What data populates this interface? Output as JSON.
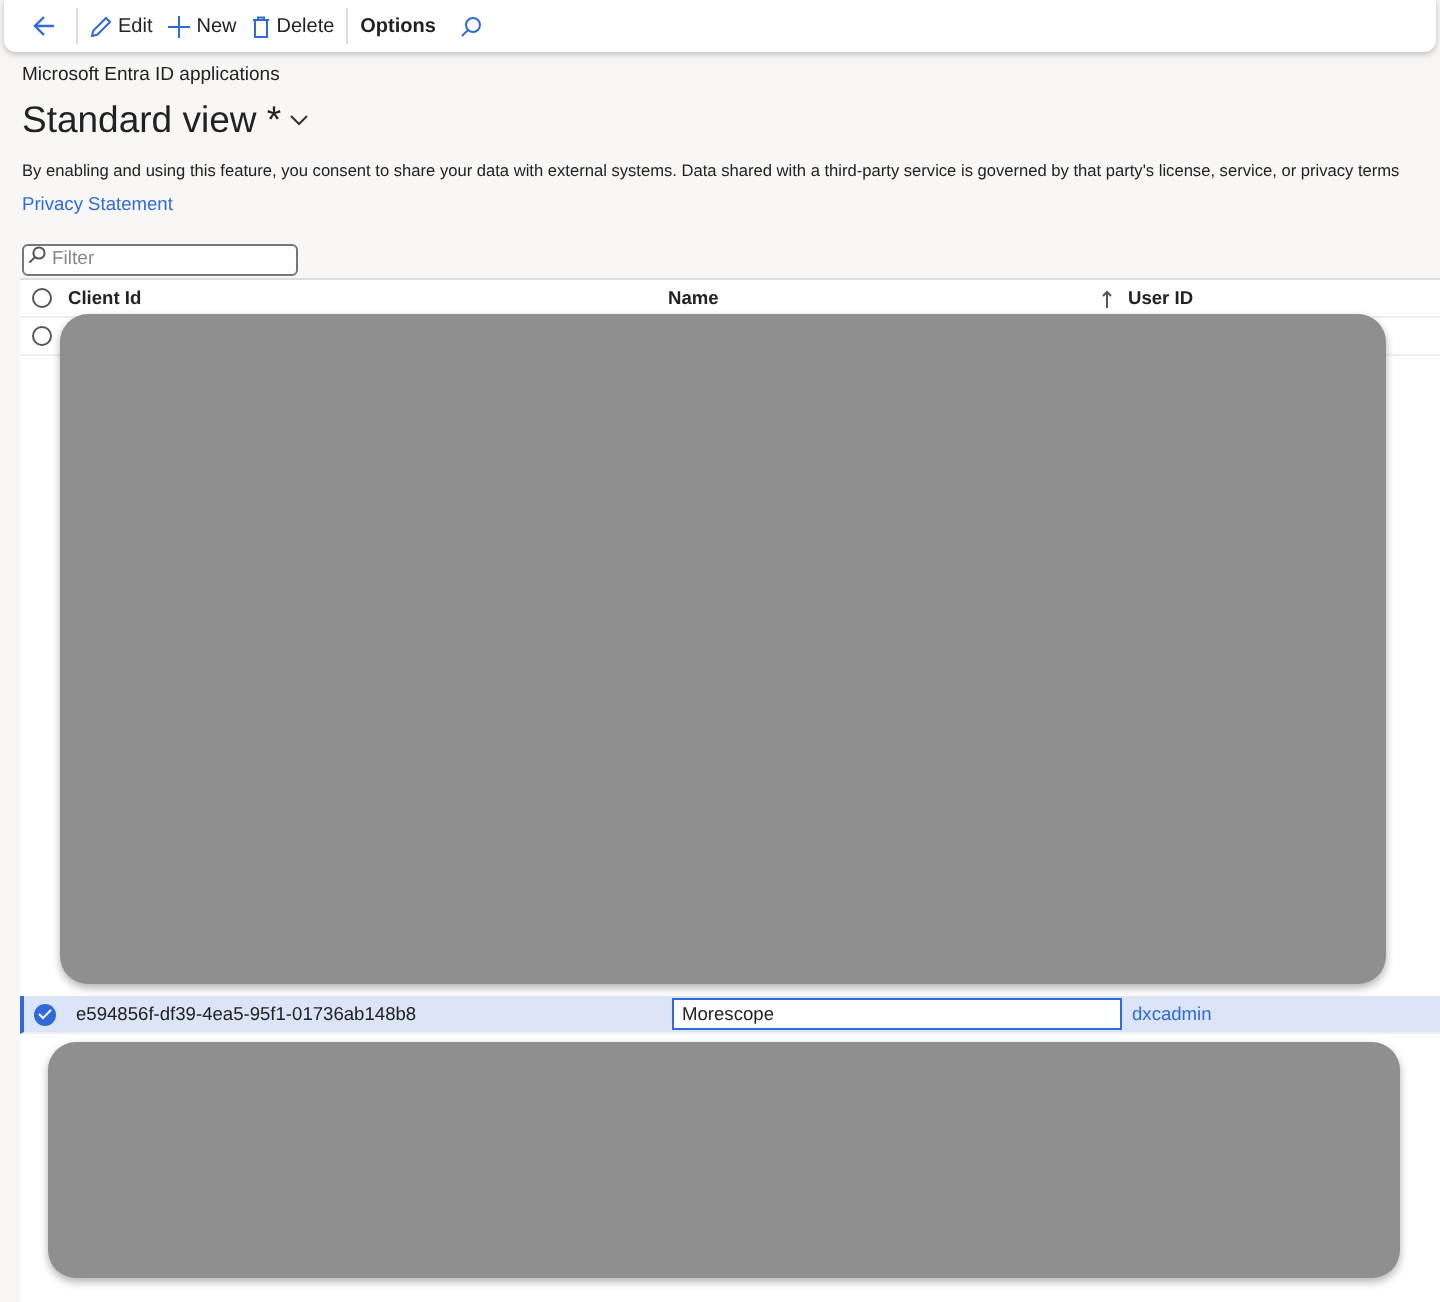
{
  "toolbar": {
    "items": [
      {
        "kind": "back"
      },
      {
        "kind": "edit",
        "label": "Edit"
      },
      {
        "kind": "new",
        "label": "New"
      },
      {
        "kind": "delete",
        "label": "Delete"
      },
      {
        "kind": "options",
        "label": "Options"
      },
      {
        "kind": "search"
      }
    ]
  },
  "page": {
    "breadcrumb": "Microsoft Entra ID applications",
    "title": "Standard view *",
    "notice": "By enabling and using this feature, you consent to share your data with external systems. Data shared with a third-party service is governed by that party's license, service, or privacy terms",
    "link": "Privacy Statement"
  },
  "filter": {
    "placeholder": "Filter"
  },
  "table": {
    "columns": [
      {
        "label": "Client Id",
        "sorted": false
      },
      {
        "label": "Name",
        "sorted": true
      },
      {
        "label": "User ID",
        "sorted": false
      }
    ],
    "select_all": {
      "checked": false
    },
    "rows": [
      {
        "selected": false
      },
      {
        "client_id": "e594856f-df39-4ea5-95f1-01736ab148b8",
        "name": "Morescope",
        "user_id": "dxcadmin",
        "selected": true
      }
    ]
  },
  "redacted_areas": [
    {
      "kind": "block"
    },
    {
      "kind": "block"
    }
  ]
}
